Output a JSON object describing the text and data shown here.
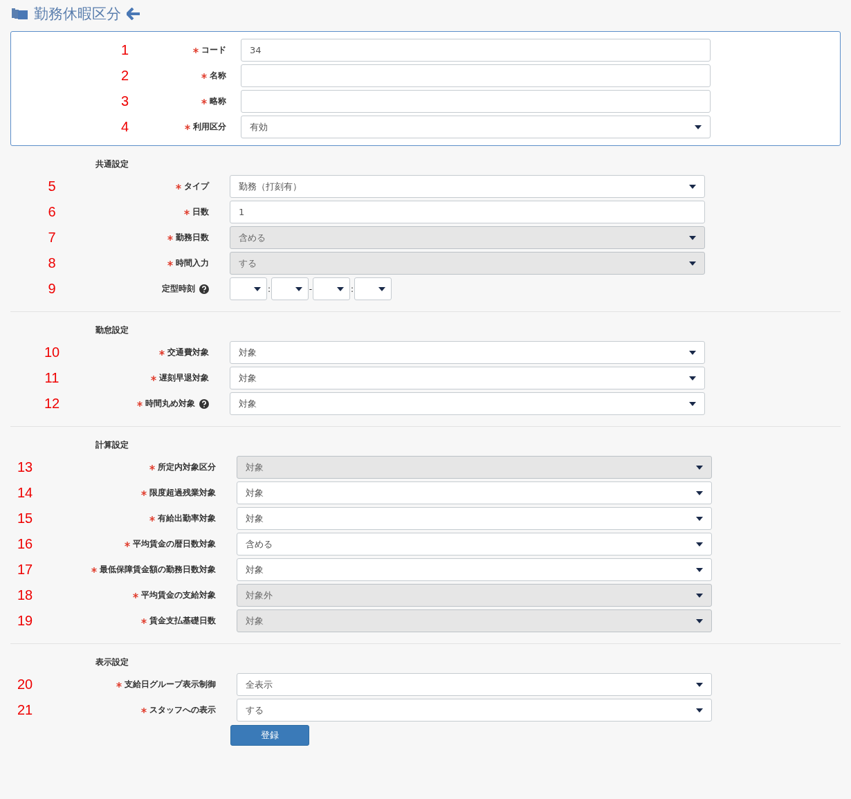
{
  "header": {
    "title": "勤務休暇区分"
  },
  "basic": [
    {
      "number": "1",
      "label": "コード",
      "required": true,
      "kind": "input",
      "value": "34"
    },
    {
      "number": "2",
      "label": "名称",
      "required": true,
      "kind": "input"
    },
    {
      "number": "3",
      "label": "略称",
      "required": true,
      "kind": "input"
    },
    {
      "number": "4",
      "label": "利用区分",
      "required": true,
      "kind": "select",
      "value": "有効",
      "disabled": false
    }
  ],
  "sections": [
    {
      "heading": "共通設定",
      "fields": [
        {
          "number": "5",
          "label": "タイプ",
          "required": true,
          "kind": "select",
          "value": "勤務（打刻有）",
          "disabled": false
        },
        {
          "number": "6",
          "label": "日数",
          "required": true,
          "kind": "input",
          "value": "1"
        },
        {
          "number": "7",
          "label": "勤務日数",
          "required": true,
          "kind": "select",
          "value": "含める",
          "disabled": true
        },
        {
          "number": "8",
          "label": "時間入力",
          "required": true,
          "kind": "select",
          "value": "する",
          "disabled": true
        },
        {
          "number": "9",
          "label": "定型時刻",
          "required": false,
          "help": true,
          "kind": "time",
          "separators": [
            ":",
            "-",
            ":"
          ]
        }
      ]
    },
    {
      "heading": "勤怠設定",
      "fields": [
        {
          "number": "10",
          "label": "交通費対象",
          "required": true,
          "kind": "select",
          "value": "対象",
          "disabled": false
        },
        {
          "number": "11",
          "label": "遅刻早退対象",
          "required": true,
          "kind": "select",
          "value": "対象",
          "disabled": false
        },
        {
          "number": "12",
          "label": "時間丸め対象",
          "required": true,
          "help": true,
          "kind": "select",
          "value": "対象",
          "disabled": false
        }
      ]
    },
    {
      "heading": "計算設定",
      "fields": [
        {
          "number": "13",
          "label": "所定内対象区分",
          "required": true,
          "kind": "select",
          "value": "対象",
          "disabled": true
        },
        {
          "number": "14",
          "label": "限度超過残業対象",
          "required": true,
          "kind": "select",
          "value": "対象",
          "disabled": false
        },
        {
          "number": "15",
          "label": "有給出勤率対象",
          "required": true,
          "kind": "select",
          "value": "対象",
          "disabled": false
        },
        {
          "number": "16",
          "label": "平均賃金の暦日数対象",
          "required": true,
          "kind": "select",
          "value": "含める",
          "disabled": false
        },
        {
          "number": "17",
          "label": "最低保障賃金額の勤務日数対象",
          "required": true,
          "kind": "select",
          "value": "対象",
          "disabled": false
        },
        {
          "number": "18",
          "label": "平均賃金の支給対象",
          "required": true,
          "kind": "select",
          "value": "対象外",
          "disabled": true
        },
        {
          "number": "19",
          "label": "賃金支払基礎日数",
          "required": true,
          "kind": "select",
          "value": "対象",
          "disabled": true
        }
      ]
    },
    {
      "heading": "表示設定",
      "fields": [
        {
          "number": "20",
          "label": "支給日グループ表示制御",
          "required": true,
          "kind": "select",
          "value": "全表示",
          "disabled": false
        },
        {
          "number": "21",
          "label": "スタッフへの表示",
          "required": true,
          "kind": "select",
          "value": "する",
          "disabled": false
        }
      ]
    }
  ],
  "submit": {
    "label": "登録"
  }
}
